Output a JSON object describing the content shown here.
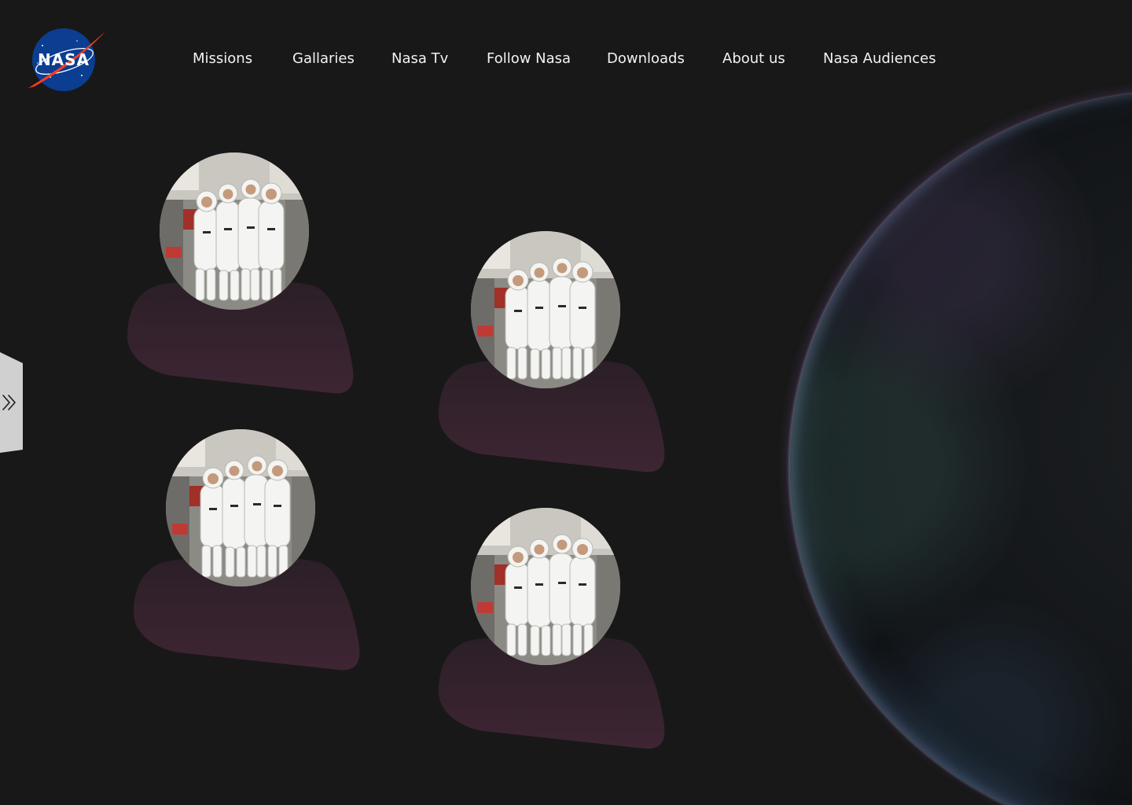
{
  "brand": {
    "logo_text": "NASA"
  },
  "nav": {
    "items": [
      {
        "label": "Missions"
      },
      {
        "label": "Gallaries"
      },
      {
        "label": "Nasa Tv"
      },
      {
        "label": "Follow Nasa"
      },
      {
        "label": "Downloads"
      },
      {
        "label": "About us"
      },
      {
        "label": "Nasa Audiences"
      }
    ]
  },
  "side_toggle": {
    "icon": "double-chevron-right-icon"
  },
  "crew_cards": [
    {
      "image": "astronaut-crew-photo"
    },
    {
      "image": "astronaut-crew-photo"
    },
    {
      "image": "astronaut-crew-photo"
    },
    {
      "image": "astronaut-crew-photo"
    }
  ],
  "colors": {
    "background": "#181818",
    "card_base_top": "#2b1f27",
    "card_base_bottom": "#3e2533",
    "nav_text": "#f2f2f2",
    "nasa_blue": "#0b3d91",
    "nasa_red": "#fc3d21"
  }
}
